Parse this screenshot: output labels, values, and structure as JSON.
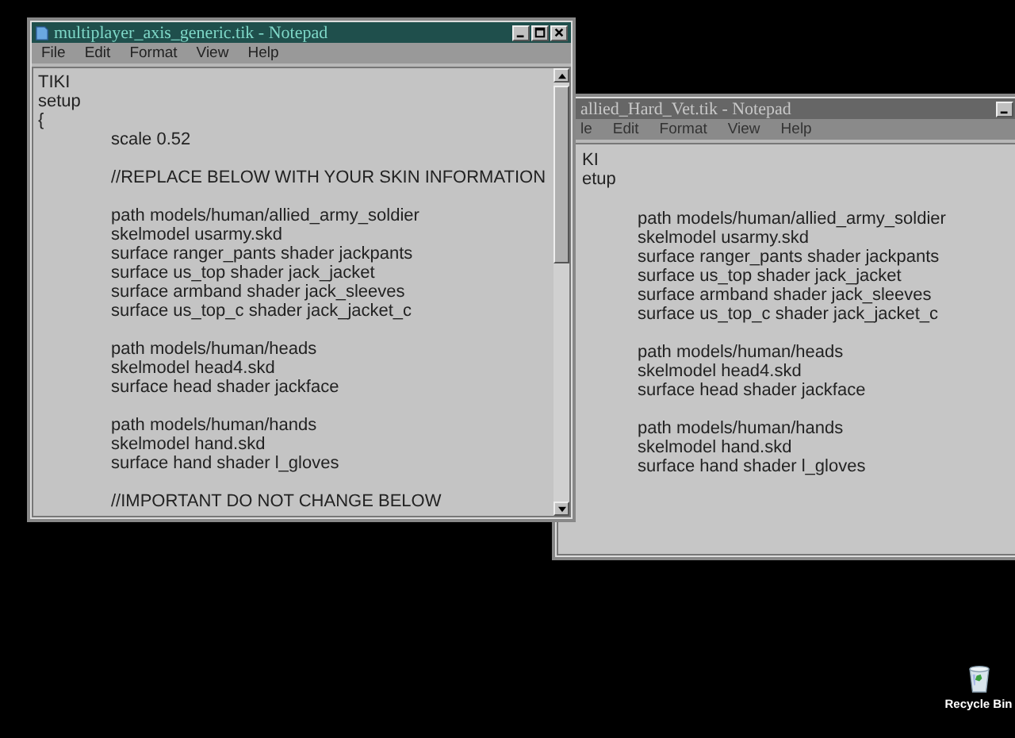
{
  "windows": [
    {
      "title": "allied_Hard_Vet.tik - Notepad",
      "active": false,
      "menu": [
        "le",
        "Edit",
        "Format",
        "View",
        "Help"
      ],
      "blocks": [
        {
          "lines": [
            {
              "text": "KI",
              "kind": "top"
            },
            {
              "text": "etup",
              "kind": "top"
            }
          ]
        },
        {
          "lines": [
            {
              "text": "path models/human/allied_army_soldier",
              "kind": "indented"
            },
            {
              "text": "skelmodel usarmy.skd",
              "kind": "indented"
            },
            {
              "text": "surface ranger_pants shader jackpants",
              "kind": "indented"
            },
            {
              "text": "surface us_top shader jack_jacket",
              "kind": "indented"
            },
            {
              "text": "surface armband shader jack_sleeves",
              "kind": "indented"
            },
            {
              "text": "surface us_top_c shader jack_jacket_c",
              "kind": "indented"
            }
          ]
        },
        {
          "lines": [
            {
              "text": "path models/human/heads",
              "kind": "indented"
            },
            {
              "text": "skelmodel head4.skd",
              "kind": "indented"
            },
            {
              "text": "surface head shader jackface",
              "kind": "indented"
            }
          ]
        },
        {
          "lines": [
            {
              "text": "path models/human/hands",
              "kind": "indented"
            },
            {
              "text": "skelmodel hand.skd",
              "kind": "indented"
            },
            {
              "text": "surface hand shader l_gloves",
              "kind": "indented"
            }
          ]
        }
      ]
    },
    {
      "title": "multiplayer_axis_generic.tik - Notepad",
      "active": true,
      "menu": [
        "File",
        "Edit",
        "Format",
        "View",
        "Help"
      ],
      "blocks": [
        {
          "lines": [
            {
              "text": "TIKI",
              "kind": "top"
            },
            {
              "text": "setup",
              "kind": "top"
            },
            {
              "text": "{",
              "kind": "top"
            },
            {
              "text": "scale 0.52",
              "kind": "indented"
            }
          ]
        },
        {
          "lines": [
            {
              "text": "//REPLACE BELOW WITH YOUR SKIN INFORMATION",
              "kind": "indented"
            }
          ]
        },
        {
          "lines": [
            {
              "text": "path models/human/allied_army_soldier",
              "kind": "indented"
            },
            {
              "text": "skelmodel usarmy.skd",
              "kind": "indented"
            },
            {
              "text": "surface ranger_pants shader jackpants",
              "kind": "indented"
            },
            {
              "text": "surface us_top shader jack_jacket",
              "kind": "indented"
            },
            {
              "text": "surface armband shader jack_sleeves",
              "kind": "indented"
            },
            {
              "text": "surface us_top_c shader jack_jacket_c",
              "kind": "indented"
            }
          ]
        },
        {
          "lines": [
            {
              "text": "path models/human/heads",
              "kind": "indented"
            },
            {
              "text": "skelmodel head4.skd",
              "kind": "indented"
            },
            {
              "text": "surface head shader jackface",
              "kind": "indented"
            }
          ]
        },
        {
          "lines": [
            {
              "text": "path models/human/hands",
              "kind": "indented"
            },
            {
              "text": "skelmodel hand.skd",
              "kind": "indented"
            },
            {
              "text": "surface hand shader l_gloves",
              "kind": "indented"
            }
          ]
        },
        {
          "lines": [
            {
              "text": "//IMPORTANT DO NOT CHANGE BELOW",
              "kind": "indented"
            }
          ]
        }
      ]
    }
  ],
  "desktop_icons": [
    {
      "label": "Recycle Bin"
    }
  ]
}
